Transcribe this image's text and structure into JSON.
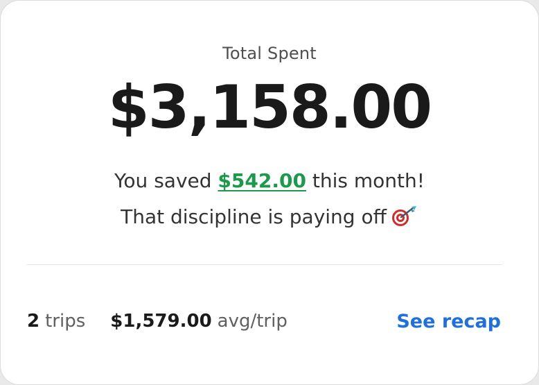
{
  "summary": {
    "total_label": "Total Spent",
    "total_amount": "$3,158.00",
    "saved_prefix": "You saved",
    "saved_amount": "$542.00",
    "saved_suffix": "this month!",
    "encouragement": "That discipline is paying off",
    "encouragement_icon": "direct-hit-target-icon"
  },
  "stats": {
    "trips_count": "2",
    "trips_label": "trips",
    "avg_amount": "$1,579.00",
    "avg_label": "avg/trip"
  },
  "actions": {
    "see_recap_label": "See recap"
  },
  "colors": {
    "saved_green": "#1a9a4a",
    "link_blue": "#1f6fe0",
    "primary_text": "#1a1a1a"
  }
}
